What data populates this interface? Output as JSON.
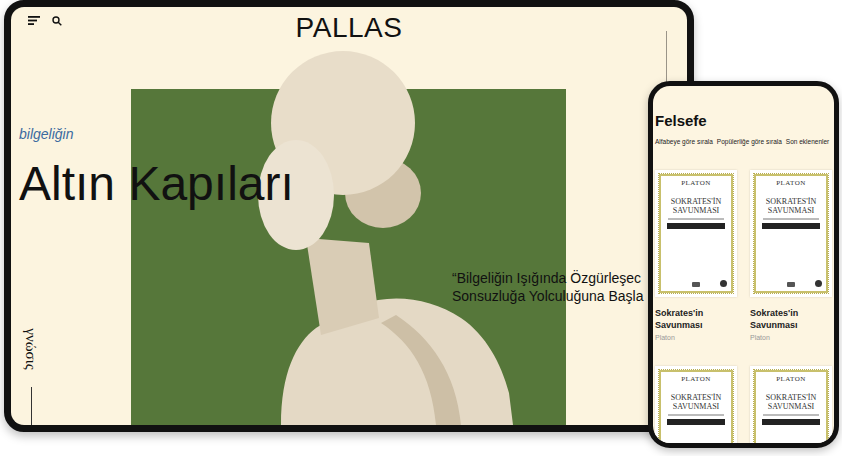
{
  "tablet": {
    "logo": "PALLAS",
    "kicker": "bilgeliğin",
    "title": "Altın Kapıları",
    "quote_lines": [
      "“Bilgeliğin Işığında Özgürleşec",
      "Sonsuzluğa Yolculuğuna Başla"
    ],
    "side_label": "γνώσις"
  },
  "phone": {
    "heading": "Felsefe",
    "sort_options": [
      "Alfabeye göre sırala",
      "Popülerliğe göre sırala",
      "Son eklenenler"
    ],
    "books": [
      {
        "cover_author": "PLATON",
        "cover_title": "SOKRATES'İN SAVUNMASI",
        "title": "Sokrates'in Savunması",
        "author": "Platon"
      },
      {
        "cover_author": "PLATON",
        "cover_title": "SOKRATES'İN SAVUNMASI",
        "title": "Sokrates'in Savunması",
        "author": "Platon"
      }
    ],
    "more_covers": [
      {
        "cover_author": "PLATON",
        "cover_title": "SOKRATES'İN SAVUNMASI"
      },
      {
        "cover_author": "PLATON",
        "cover_title": "SOKRATES'İN SAVUNMASI"
      }
    ]
  }
}
